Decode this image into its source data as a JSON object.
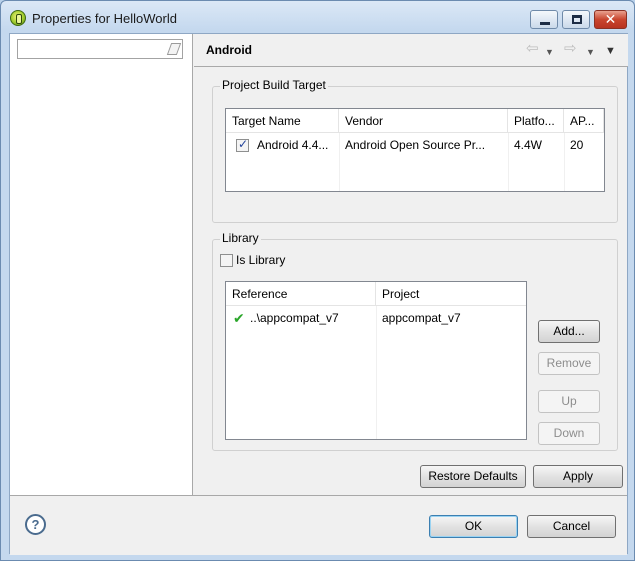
{
  "window": {
    "title": "Properties for HelloWorld",
    "minimize": "—",
    "maximize": "□",
    "close": "✕"
  },
  "sidebar": {
    "filter_value": ""
  },
  "page": {
    "title": "Android",
    "nav": {
      "back": "⇦",
      "back_dd": "▼",
      "forward": "⇨",
      "forward_dd": "▼",
      "menu": "▼"
    }
  },
  "build_target": {
    "group_label": "Project Build Target",
    "columns": [
      "Target Name",
      "Vendor",
      "Platfo...",
      "AP..."
    ],
    "rows": [
      {
        "checked": true,
        "target_name": "Android 4.4...",
        "vendor": "Android Open Source Pr...",
        "platform": "4.4W",
        "api": "20"
      }
    ]
  },
  "library": {
    "group_label": "Library",
    "is_library_label": "Is Library",
    "is_library_checked": false,
    "columns": [
      "Reference",
      "Project"
    ],
    "rows": [
      {
        "status_icon": "green-checkmark-icon",
        "reference": "..\\appcompat_v7",
        "project": "appcompat_v7"
      }
    ],
    "buttons": {
      "add": "Add...",
      "remove": "Remove",
      "up": "Up",
      "down": "Down"
    }
  },
  "actions": {
    "restore_defaults": "Restore Defaults",
    "apply": "Apply"
  },
  "footer": {
    "help": "?",
    "ok": "OK",
    "cancel": "Cancel"
  }
}
